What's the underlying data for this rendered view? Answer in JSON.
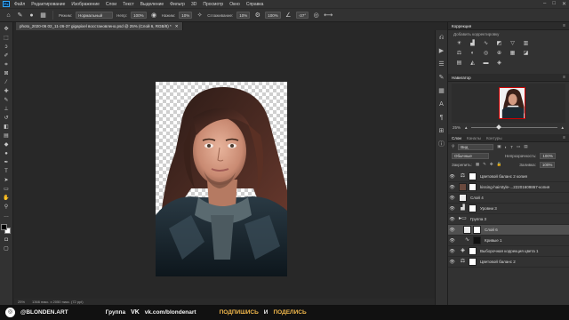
{
  "app": {
    "logo_text": "Ps"
  },
  "menu": [
    "Файл",
    "Редактирование",
    "Изображение",
    "Слои",
    "Текст",
    "Выделение",
    "Фильтр",
    "3D",
    "Просмотр",
    "Окно",
    "Справка"
  ],
  "options": {
    "mode_label": "Режим:",
    "mode_value": "Нормальный",
    "opacity_label": "Непр:",
    "opacity_value": "100%",
    "flow_label": "Нажим:",
    "flow_value": "10%",
    "smoothing_label": "Сглаживание:",
    "smoothing_value": "10%",
    "size_value": "100%",
    "angle_value": "-37°"
  },
  "document": {
    "tab_title": "photo_2020-06 02_11-26-37 gigapixel восстановлено.psd @ 25% (Слой 6, RGB/8) *"
  },
  "status": {
    "zoom": "25%",
    "doc_size": "1366 пикс. x 2050 пикс. (72 ppi)"
  },
  "panels": {
    "corrections_tab": "Коррекция",
    "corrections_sub": "Добавить корректировку",
    "navigator_tab": "Навигатор",
    "nav_zoom": "25%",
    "layers_tab": "Слои",
    "channels_tab": "Каналы",
    "contours_tab": "Контуры"
  },
  "layers_panel": {
    "kind_value": "Вид",
    "blend_value": "Обычные",
    "opacity_label": "Непрозрачность:",
    "opacity_value": "100%",
    "lock_label": "Закрепить:",
    "fill_label": "Заливка:",
    "fill_value": "100%"
  },
  "layers": [
    {
      "name": "Цветовой баланс 2 копия",
      "kind": "adjustment",
      "selected": false
    },
    {
      "name": "kissing-hairstyle-...22201609867-копия",
      "kind": "image",
      "selected": false
    },
    {
      "name": "Слой 4",
      "kind": "image",
      "selected": false
    },
    {
      "name": "Уровни 3",
      "kind": "adjustment",
      "selected": false
    },
    {
      "name": "Группа 3",
      "kind": "group",
      "selected": false
    },
    {
      "name": "Слой 6",
      "kind": "image",
      "selected": true
    },
    {
      "name": "Кривые 1",
      "kind": "adjustment",
      "selected": false
    },
    {
      "name": "Выборочная коррекция цвета 1",
      "kind": "adjustment",
      "selected": false
    },
    {
      "name": "Цветовой баланс 2",
      "kind": "adjustment",
      "selected": false
    }
  ],
  "footer": {
    "instagram": "@BLONDEN.ART",
    "group_label": "Группа",
    "vk_link": "vk.com/blondenart",
    "subscribe": "ПОДПИШИСЬ",
    "and": "И",
    "share": "ПОДЕЛИСЬ"
  },
  "icons": {
    "toolbar": [
      "move-icon",
      "marquee-icon",
      "lasso-icon",
      "quick-select-icon",
      "crop-icon",
      "frame-icon",
      "eyedropper-icon",
      "healing-icon",
      "brush-icon",
      "stamp-icon",
      "history-brush-icon",
      "eraser-icon",
      "gradient-icon",
      "blur-icon",
      "dodge-icon",
      "pen-icon",
      "type-icon",
      "path-select-icon",
      "rectangle-icon",
      "hand-icon",
      "zoom-icon",
      "more-icon"
    ]
  },
  "colors": {
    "accent": "#31a8ff",
    "footer_highlight": "#f2b84b",
    "selected_layer": "#505050"
  }
}
